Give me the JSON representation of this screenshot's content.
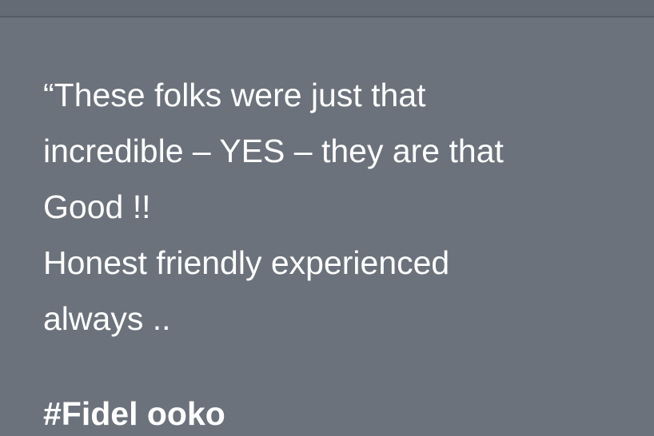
{
  "testimonial": {
    "quote_lines": [
      "“These folks were just that",
      "incredible – YES – they are that",
      "Good !!",
      "Honest friendly experienced",
      "always .."
    ],
    "author": "#Fidel ooko"
  },
  "colors": {
    "background": "#6b727b",
    "text": "#ffffff"
  }
}
